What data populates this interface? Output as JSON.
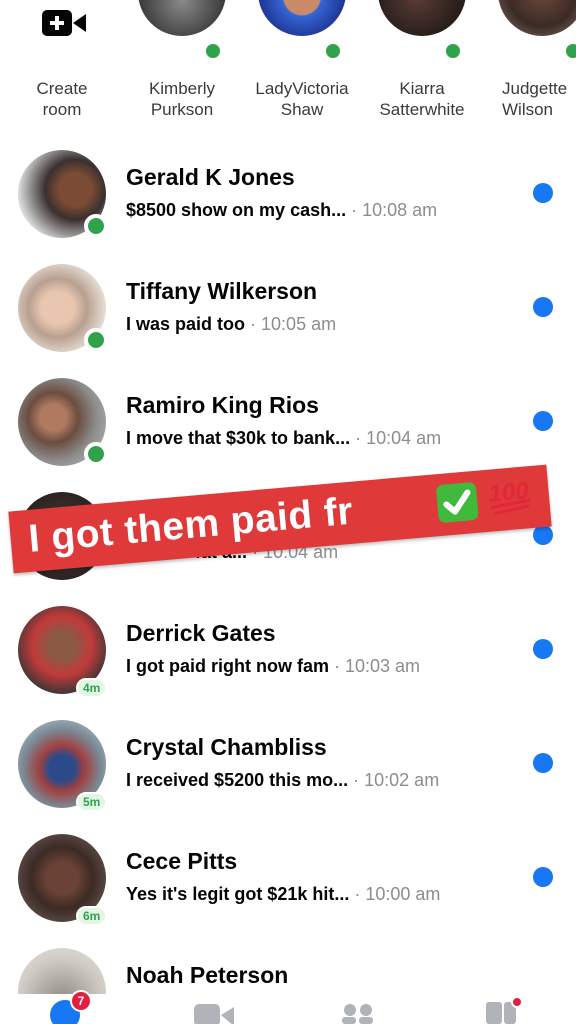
{
  "stories": [
    {
      "name": "Create\nroom",
      "line1": "Create",
      "line2": "room",
      "icon": "video-plus-icon"
    },
    {
      "line1": "Kimberly",
      "line2": "Purkson",
      "online": true
    },
    {
      "line1": "LadyVictoria",
      "line2": "Shaw",
      "online": true
    },
    {
      "line1": "Kiarra",
      "line2": "Satterwhite",
      "online": true
    },
    {
      "line1": "Judgette",
      "line2": "Wilson",
      "online": true
    }
  ],
  "chats": [
    {
      "name": "Gerald K Jones",
      "message": "$8500 show on my cash...",
      "time": "10:08 am",
      "status": "online",
      "unread": true
    },
    {
      "name": "Tiffany Wilkerson",
      "message": "I was paid too",
      "time": "10:05 am",
      "status": "online",
      "unread": true
    },
    {
      "name": "Ramiro King Rios",
      "message": "I move that $30k to bank...",
      "time": "10:04 am",
      "status": "online",
      "unread": true
    },
    {
      "name": "",
      "message": "...was a fat a...",
      "time": "10:04 am",
      "status": "none",
      "unread": true
    },
    {
      "name": "Derrick Gates",
      "message": "I got paid right now fam",
      "time": "10:03 am",
      "status": "4m",
      "unread": true
    },
    {
      "name": "Crystal Chambliss",
      "message": "I received $5200 this mo...",
      "time": "10:02 am",
      "status": "5m",
      "unread": true
    },
    {
      "name": "Cece Pitts",
      "message": "Yes it's legit got $21k hit...",
      "time": "10:00 am",
      "status": "6m",
      "unread": true
    },
    {
      "name": "Noah Peterson",
      "message": "",
      "time": "",
      "status": "none",
      "unread": false
    }
  ],
  "banner": {
    "text": "I got them paid fr",
    "emojis": [
      "check-mark-icon",
      "hundred-points-icon"
    ]
  },
  "nav": {
    "chats_badge": "7",
    "icons": [
      "chats-icon",
      "video-icon",
      "people-icon",
      "stories-icon"
    ]
  },
  "colors": {
    "online": "#31a24c",
    "unread": "#1877f2",
    "banner": "#e0393a",
    "badge": "#e41e3f"
  }
}
